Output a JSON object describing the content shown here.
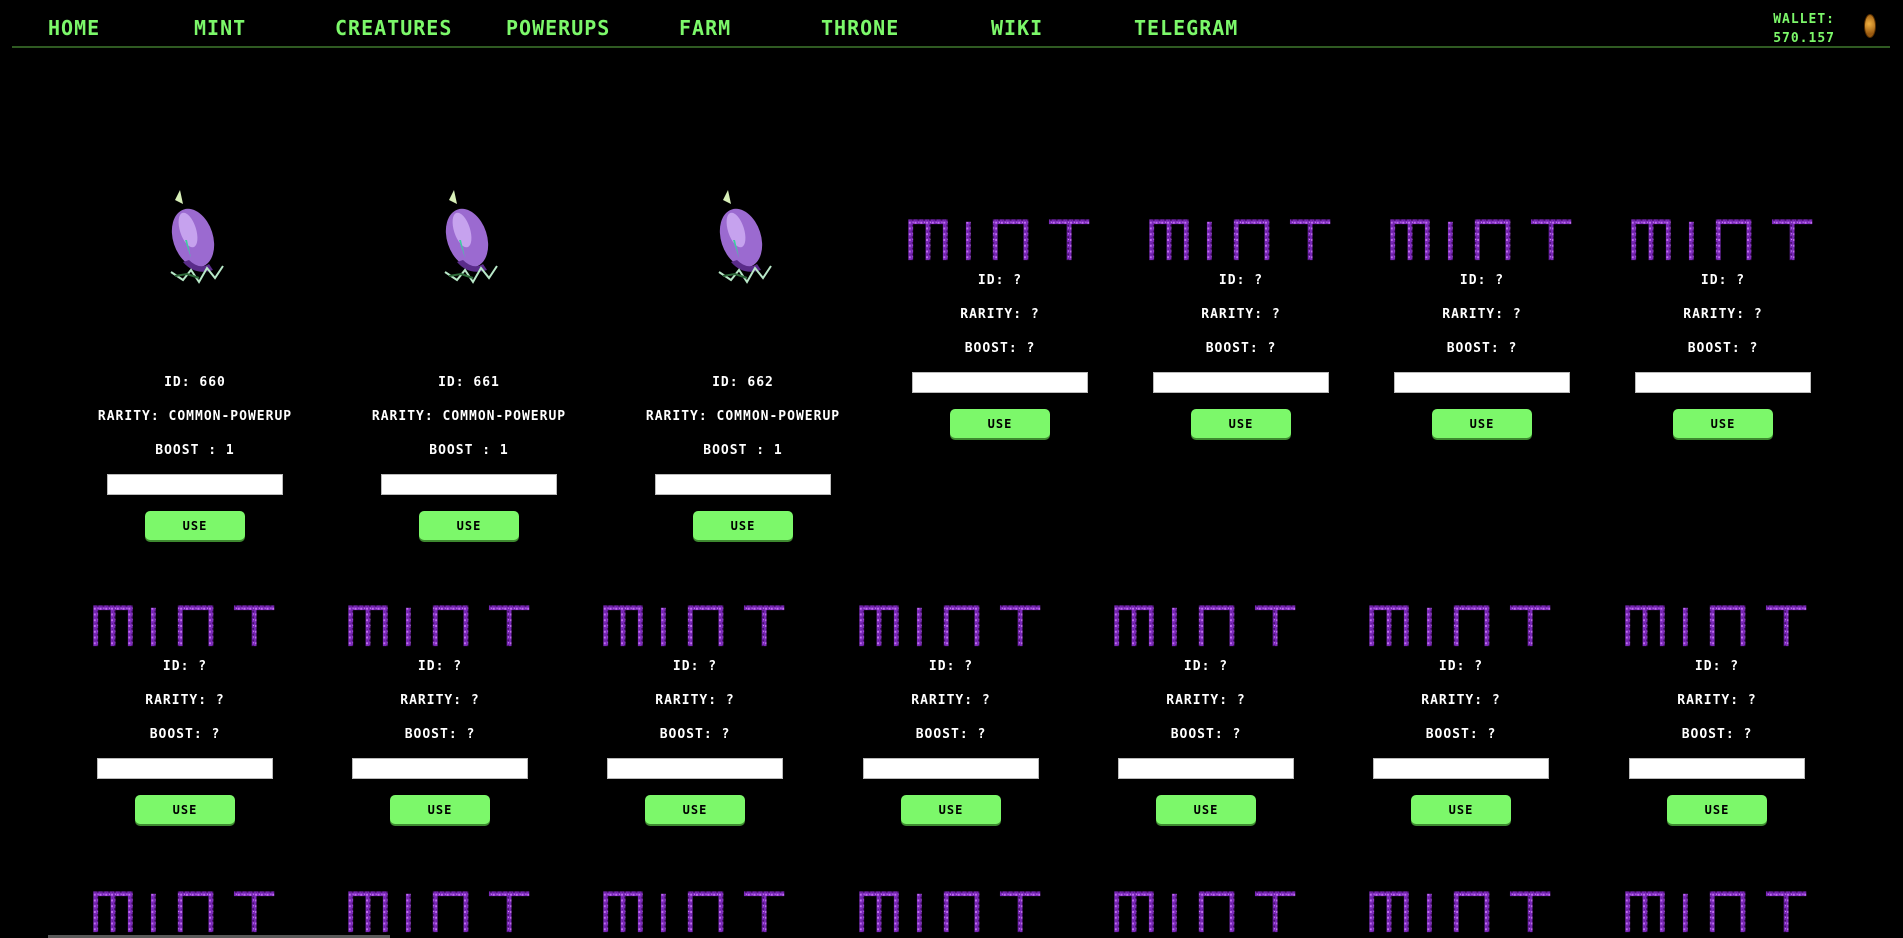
{
  "nav": {
    "items": [
      "HOME",
      "MINT",
      "CREATURES",
      "POWERUPS",
      "FARM",
      "THRONE",
      "WIKI",
      "TELEGRAM"
    ],
    "wallet_label": "WALLET:",
    "wallet_value": "570.157"
  },
  "owned_powerups": [
    {
      "id": "ID: 660",
      "rarity": "RARITY: COMMON-POWERUP",
      "boost": "BOOST : 1",
      "button": "USE"
    },
    {
      "id": "ID: 661",
      "rarity": "RARITY: COMMON-POWERUP",
      "boost": "BOOST : 1",
      "button": "USE"
    },
    {
      "id": "ID: 662",
      "rarity": "RARITY: COMMON-POWERUP",
      "boost": "BOOST : 1",
      "button": "USE"
    }
  ],
  "placeholder_card": {
    "logo_text": "MINT",
    "id": "ID: ?",
    "rarity": "RARITY: ?",
    "boost": "BOOST: ?",
    "button": "USE"
  },
  "colors": {
    "accent_green": "#7cf86a",
    "mint_purple": "#9b3fd8",
    "background": "#000000"
  }
}
